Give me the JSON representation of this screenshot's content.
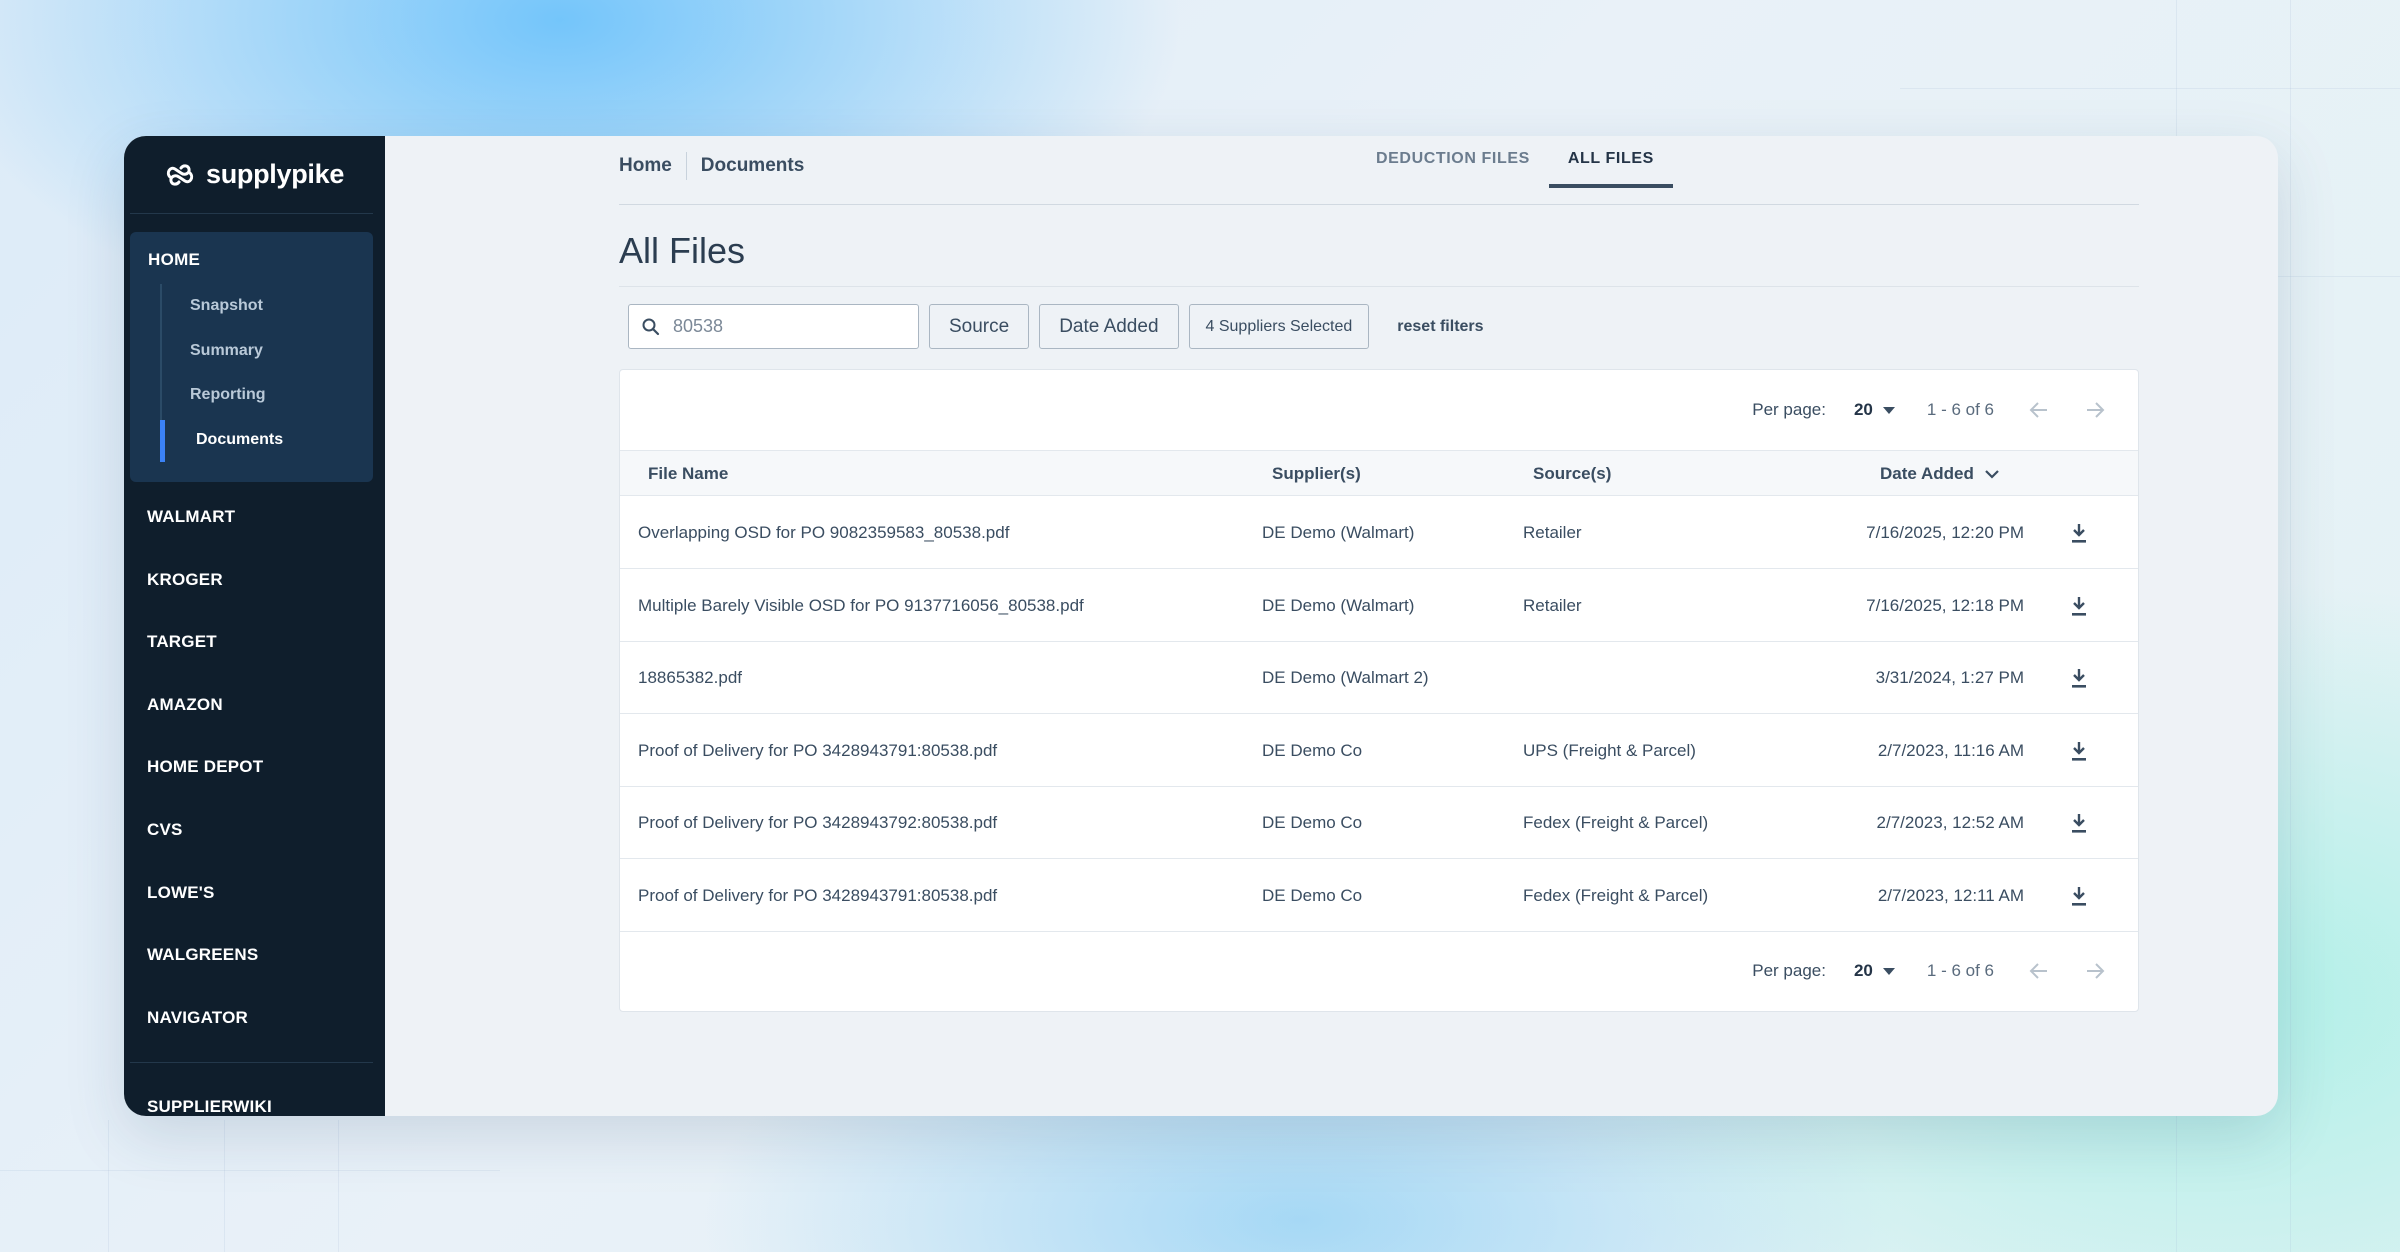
{
  "sidebar": {
    "logo": "supplypike",
    "home": {
      "label": "HOME",
      "items": [
        {
          "label": "Snapshot"
        },
        {
          "label": "Summary"
        },
        {
          "label": "Reporting"
        },
        {
          "label": "Documents",
          "active": true
        }
      ]
    },
    "nav": [
      "WALMART",
      "KROGER",
      "TARGET",
      "AMAZON",
      "HOME DEPOT",
      "CVS",
      "LOWE'S",
      "WALGREENS",
      "NAVIGATOR"
    ],
    "footer_item": "SUPPLIERWIKI"
  },
  "breadcrumb": [
    "Home",
    "Documents"
  ],
  "tabs": [
    {
      "label": "DEDUCTION FILES",
      "active": false
    },
    {
      "label": "ALL FILES",
      "active": true
    }
  ],
  "page_title": "All Files",
  "filters": {
    "search_value": "80538",
    "source": "Source",
    "date_added": "Date Added",
    "suppliers": "4 Suppliers Selected",
    "reset": "reset filters"
  },
  "pagination": {
    "per_page_label": "Per page:",
    "per_page": "20",
    "range": "1 - 6 of 6"
  },
  "table": {
    "columns": [
      "File Name",
      "Supplier(s)",
      "Source(s)",
      "Date Added"
    ],
    "sort_column": "Date Added",
    "rows": [
      {
        "file": "Overlapping OSD for PO 9082359583_80538.pdf",
        "supplier": "DE Demo (Walmart)",
        "source": "Retailer",
        "date": "7/16/2025, 12:20 PM"
      },
      {
        "file": "Multiple Barely Visible OSD for PO 9137716056_80538.pdf",
        "supplier": "DE Demo (Walmart)",
        "source": "Retailer",
        "date": "7/16/2025, 12:18 PM"
      },
      {
        "file": "18865382.pdf",
        "supplier": "DE Demo (Walmart 2)",
        "source": "",
        "date": "3/31/2024, 1:27 PM"
      },
      {
        "file": "Proof of Delivery for PO 3428943791:80538.pdf",
        "supplier": "DE Demo Co",
        "source": "UPS (Freight & Parcel)",
        "date": "2/7/2023, 11:16 AM"
      },
      {
        "file": "Proof of Delivery for PO 3428943792:80538.pdf",
        "supplier": "DE Demo Co",
        "source": "Fedex (Freight & Parcel)",
        "date": "2/7/2023, 12:52 AM"
      },
      {
        "file": "Proof of Delivery for PO 3428943791:80538.pdf",
        "supplier": "DE Demo Co",
        "source": "Fedex (Freight & Parcel)",
        "date": "2/7/2023, 12:11 AM"
      }
    ]
  },
  "colors": {
    "sidebar_bg": "#0f1e2c",
    "sidebar_active_group": "#1a3550",
    "accent": "#3b82f6",
    "text": "#3a4d61"
  }
}
